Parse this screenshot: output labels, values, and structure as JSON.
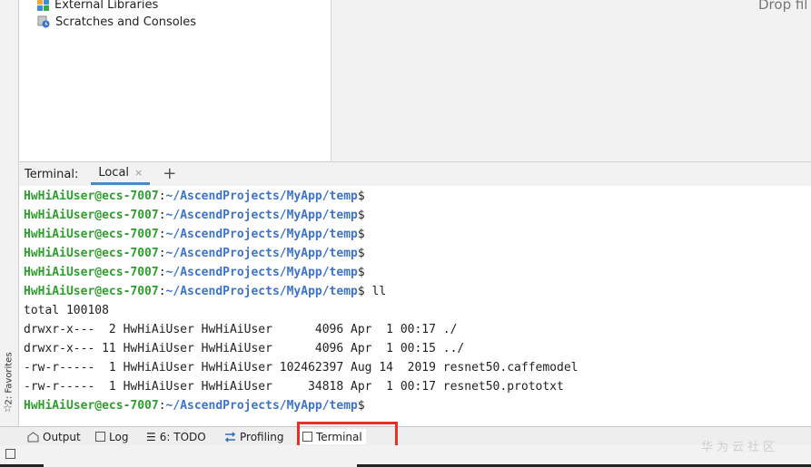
{
  "project_tree": {
    "items": [
      {
        "label": "External Libraries",
        "icon": "library-icon"
      },
      {
        "label": "Scratches and Consoles",
        "icon": "scratches-icon"
      }
    ]
  },
  "editor": {
    "drop_hint": "Drop fil"
  },
  "side_bar": {
    "favorites_label": "2: Favorites"
  },
  "terminal": {
    "title": "Terminal:",
    "tabs": [
      {
        "label": "Local",
        "close": "×"
      }
    ],
    "add_tab": "+",
    "lines": [
      {
        "user": "HwHiAiUser@ecs-7007",
        "sep": ":",
        "path": "~/AscendProjects/MyApp/temp",
        "rest": "$"
      },
      {
        "user": "HwHiAiUser@ecs-7007",
        "sep": ":",
        "path": "~/AscendProjects/MyApp/temp",
        "rest": "$"
      },
      {
        "user": "HwHiAiUser@ecs-7007",
        "sep": ":",
        "path": "~/AscendProjects/MyApp/temp",
        "rest": "$"
      },
      {
        "user": "HwHiAiUser@ecs-7007",
        "sep": ":",
        "path": "~/AscendProjects/MyApp/temp",
        "rest": "$"
      },
      {
        "user": "HwHiAiUser@ecs-7007",
        "sep": ":",
        "path": "~/AscendProjects/MyApp/temp",
        "rest": "$"
      },
      {
        "user": "HwHiAiUser@ecs-7007",
        "sep": ":",
        "path": "~/AscendProjects/MyApp/temp",
        "rest": "$ ll"
      },
      {
        "text": "total 100108"
      },
      {
        "text": "drwxr-x---  2 HwHiAiUser HwHiAiUser      4096 Apr  1 00:17 ./"
      },
      {
        "text": "drwxr-x--- 11 HwHiAiUser HwHiAiUser      4096 Apr  1 00:15 ../"
      },
      {
        "text": "-rw-r-----  1 HwHiAiUser HwHiAiUser 102462397 Aug 14  2019 resnet50.caffemodel"
      },
      {
        "text": "-rw-r-----  1 HwHiAiUser HwHiAiUser     34818 Apr  1 00:17 resnet50.prototxt"
      },
      {
        "user": "HwHiAiUser@ecs-7007",
        "sep": ":",
        "path": "~/AscendProjects/MyApp/temp",
        "rest": "$"
      }
    ]
  },
  "tool_windows": {
    "output": "Output",
    "log": "Log",
    "todo": "6: TODO",
    "profiling": "Profiling",
    "terminal": "Terminal"
  },
  "watermark": "华为云社区",
  "colors": {
    "user": "#2e9e2e",
    "path": "#3d74c7",
    "highlight": "#e8302a"
  }
}
